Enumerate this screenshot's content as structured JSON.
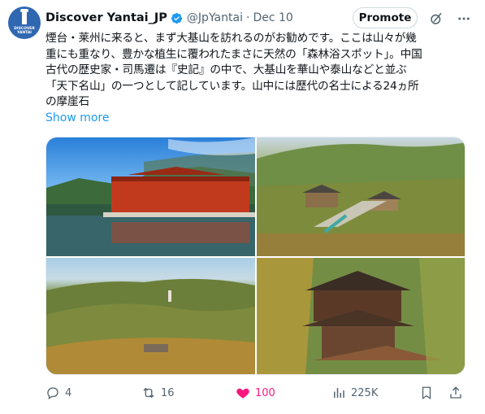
{
  "account": {
    "avatar_text": "DISCOVER YANTAI",
    "name": "Discover Yantai_JP",
    "handle": "@JpYantai",
    "separator": "·",
    "date": "Dec 10"
  },
  "header_actions": {
    "promote_label": "Promote",
    "grok_icon": "grok-icon",
    "more_icon": "more-icon"
  },
  "tweet": {
    "text": "煙台・莱州に来ると、まず大基山を訪れるのがお勧めです。ここは山々が幾\n重にも重なり、豊かな植生に覆われたまさに天然の「森林浴スポット」。中国\n古代の歴史家・司馬遷は『史記』の中で、大基山を華山や泰山などと並ぶ\n「天下名山」の一つとして記しています。山中には歴代の名士による24ヵ所\nの摩崖石",
    "show_more": "Show more"
  },
  "photos": [
    {
      "alt": "red-temple-by-lake"
    },
    {
      "alt": "temple-complex-on-hillside"
    },
    {
      "alt": "mountain-valley-view"
    },
    {
      "alt": "pagoda-among-trees"
    }
  ],
  "engagement": {
    "replies": "4",
    "reposts": "16",
    "likes": "100",
    "views": "225K"
  },
  "colors": {
    "accent": "#1d9bf0",
    "like": "#f91880",
    "muted": "#536471"
  }
}
